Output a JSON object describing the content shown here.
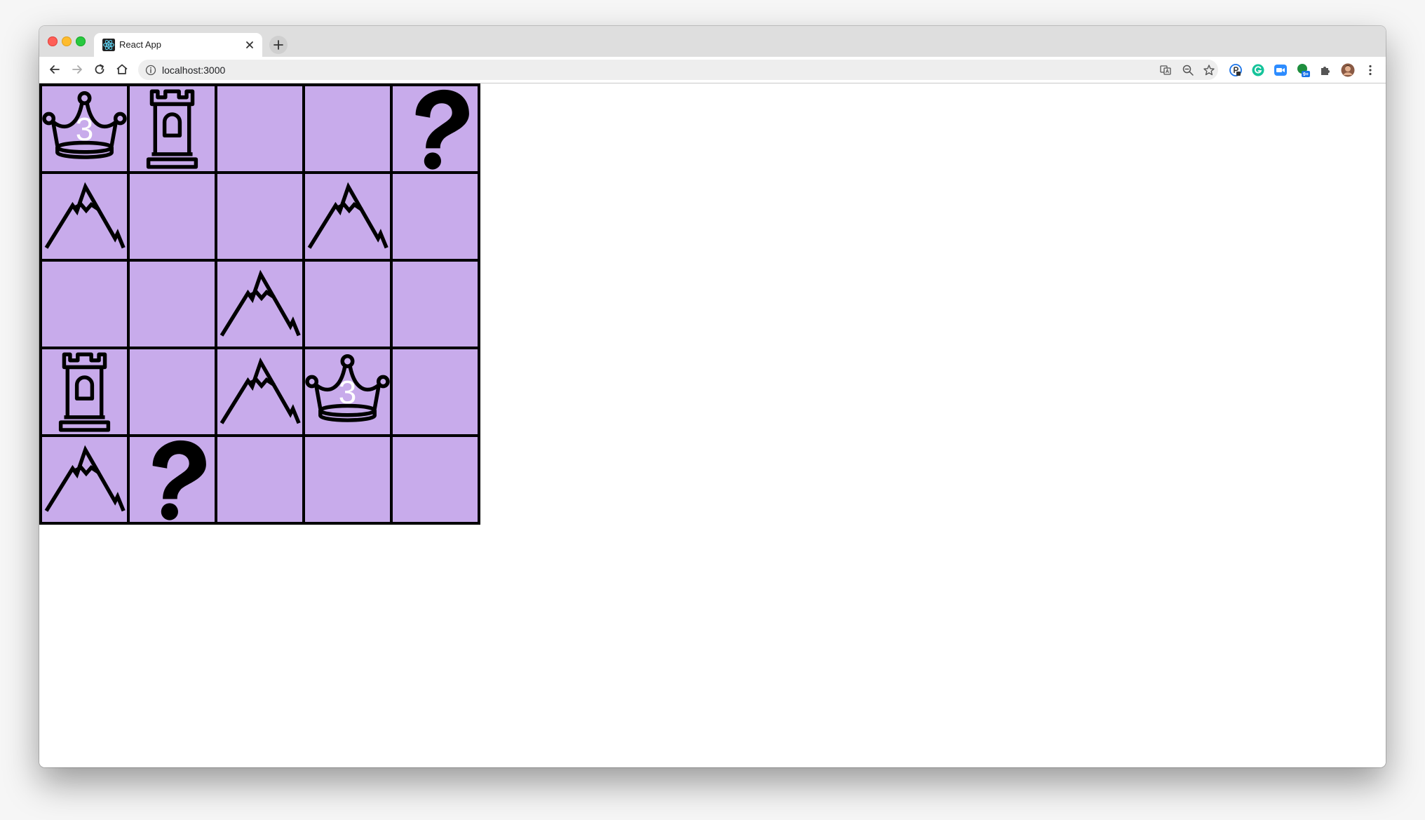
{
  "browser": {
    "tab_title": "React App",
    "url": "localhost:3000"
  },
  "icons": {
    "toolbar": [
      "back-arrow-icon",
      "forward-arrow-icon",
      "reload-icon",
      "home-icon",
      "info-icon",
      "translate-icon",
      "zoom-icon",
      "bookmark-star-icon"
    ],
    "extensions": [
      "password-extension-icon",
      "grammarly-extension-icon",
      "zoom-extension-icon",
      "green-extension-icon",
      "puzzle-icon",
      "profile-avatar",
      "kebab-menu-icon"
    ]
  },
  "colors": {
    "cell_fill": "#c8abeb",
    "grid_line": "#000000",
    "count_text": "#ffffff"
  },
  "board": {
    "rows": [
      [
        {
          "piece": "crown",
          "count": "3"
        },
        {
          "piece": "tower",
          "count": ""
        },
        {
          "piece": "empty",
          "count": ""
        },
        {
          "piece": "empty",
          "count": ""
        },
        {
          "piece": "question",
          "count": ""
        }
      ],
      [
        {
          "piece": "mountain",
          "count": ""
        },
        {
          "piece": "empty",
          "count": ""
        },
        {
          "piece": "empty",
          "count": ""
        },
        {
          "piece": "mountain",
          "count": ""
        },
        {
          "piece": "empty",
          "count": ""
        }
      ],
      [
        {
          "piece": "empty",
          "count": ""
        },
        {
          "piece": "empty",
          "count": ""
        },
        {
          "piece": "mountain",
          "count": ""
        },
        {
          "piece": "empty",
          "count": ""
        },
        {
          "piece": "empty",
          "count": ""
        }
      ],
      [
        {
          "piece": "tower",
          "count": ""
        },
        {
          "piece": "empty",
          "count": ""
        },
        {
          "piece": "mountain",
          "count": ""
        },
        {
          "piece": "crown",
          "count": "3"
        },
        {
          "piece": "empty",
          "count": ""
        }
      ],
      [
        {
          "piece": "mountain",
          "count": ""
        },
        {
          "piece": "question",
          "count": ""
        },
        {
          "piece": "empty",
          "count": ""
        },
        {
          "piece": "empty",
          "count": ""
        },
        {
          "piece": "empty",
          "count": ""
        }
      ]
    ]
  }
}
